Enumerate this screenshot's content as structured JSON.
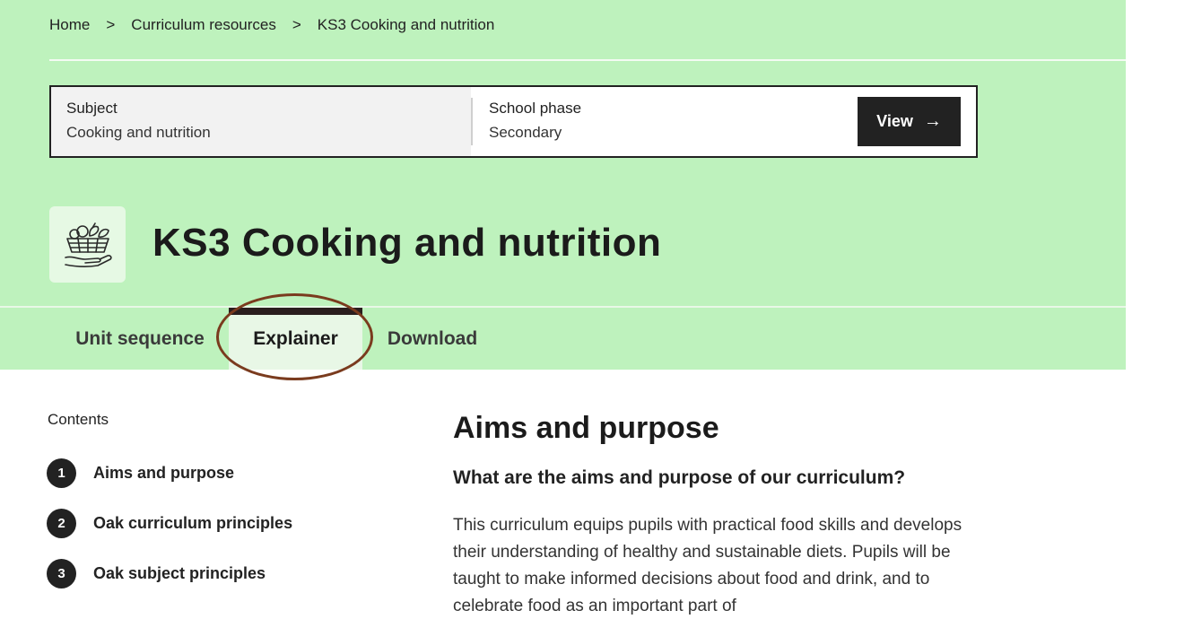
{
  "breadcrumb": {
    "items": [
      "Home",
      "Curriculum resources",
      "KS3 Cooking and nutrition"
    ],
    "separator": ">"
  },
  "selector": {
    "subject_label": "Subject",
    "subject_value": "Cooking and nutrition",
    "phase_label": "School phase",
    "phase_value": "Secondary",
    "view_label": "View",
    "view_icon": "arrow-right-icon"
  },
  "header": {
    "icon": "food-basket-icon",
    "title": "KS3 Cooking and nutrition"
  },
  "tabs": [
    {
      "label": "Unit sequence",
      "active": false
    },
    {
      "label": "Explainer",
      "active": true
    },
    {
      "label": "Download",
      "active": false
    }
  ],
  "contents": {
    "title": "Contents",
    "items": [
      {
        "number": "1",
        "label": "Aims and purpose"
      },
      {
        "number": "2",
        "label": "Oak curriculum principles"
      },
      {
        "number": "3",
        "label": "Oak subject principles"
      }
    ]
  },
  "main": {
    "heading": "Aims and purpose",
    "subheading": "What are the aims and purpose of our curriculum?",
    "body": "This curriculum equips pupils with practical food skills and develops their understanding of healthy and sustainable diets. Pupils will be taught to make informed decisions about food and drink, and to celebrate food as an important part of"
  },
  "colors": {
    "hero_bg": "#bef2bd",
    "active_tab_bg": "#e8f7e6",
    "dark": "#222222",
    "highlight_ring": "#7a3b1e"
  }
}
